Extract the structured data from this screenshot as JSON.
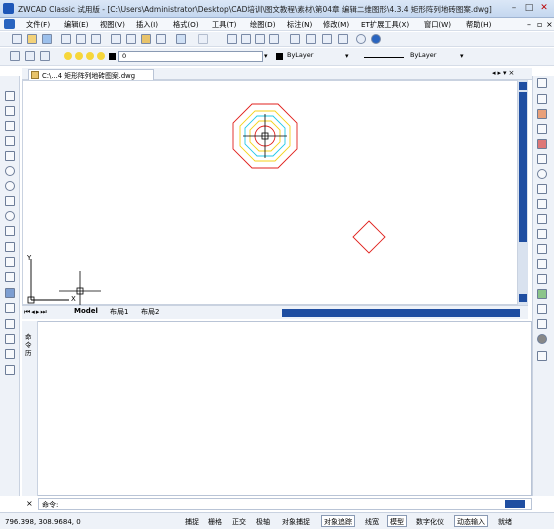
{
  "title_bar": {
    "title": "ZWCAD Classic 试用版 - [C:\\Users\\Administrator\\Desktop\\CAD培训\\图文教程\\素材\\第04章 编辑二维图形\\4.3.4 矩形阵列地砖图案.dwg]"
  },
  "menu": [
    "文件(F)",
    "编辑(E)",
    "视图(V)",
    "插入(I)",
    "格式(O)",
    "工具(T)",
    "绘图(D)",
    "标注(N)",
    "修改(M)",
    "ET扩展工具(X)",
    "窗口(W)",
    "帮助(H)"
  ],
  "layer_combo": "0",
  "color_combo": "ByLayer",
  "linetype_combo": "ByLayer",
  "doc_tab": "C:\\...4 矩形阵列地砖图案.dwg",
  "layout_tabs": [
    "Model",
    "布局1",
    "布局2"
  ],
  "ucs": {
    "x": "X",
    "y": "Y"
  },
  "cmd_side_label": "命令历",
  "cmd_prompt": "命令:",
  "status": {
    "coords": "796.398, 308.9684, 0",
    "buttons": [
      "捕捉",
      "栅格",
      "正交",
      "极轴",
      "对象捕捉",
      "对象追踪",
      "线宽",
      "模型",
      "数字化仪",
      "动态输入",
      "就绪"
    ],
    "active": [
      5,
      7,
      9
    ]
  },
  "colors": {
    "octagon_outer": "#e0201c",
    "ring_yellow": "#f4d21b",
    "ring_cyan": "#20c8e8",
    "diamond": "#e0201c"
  }
}
